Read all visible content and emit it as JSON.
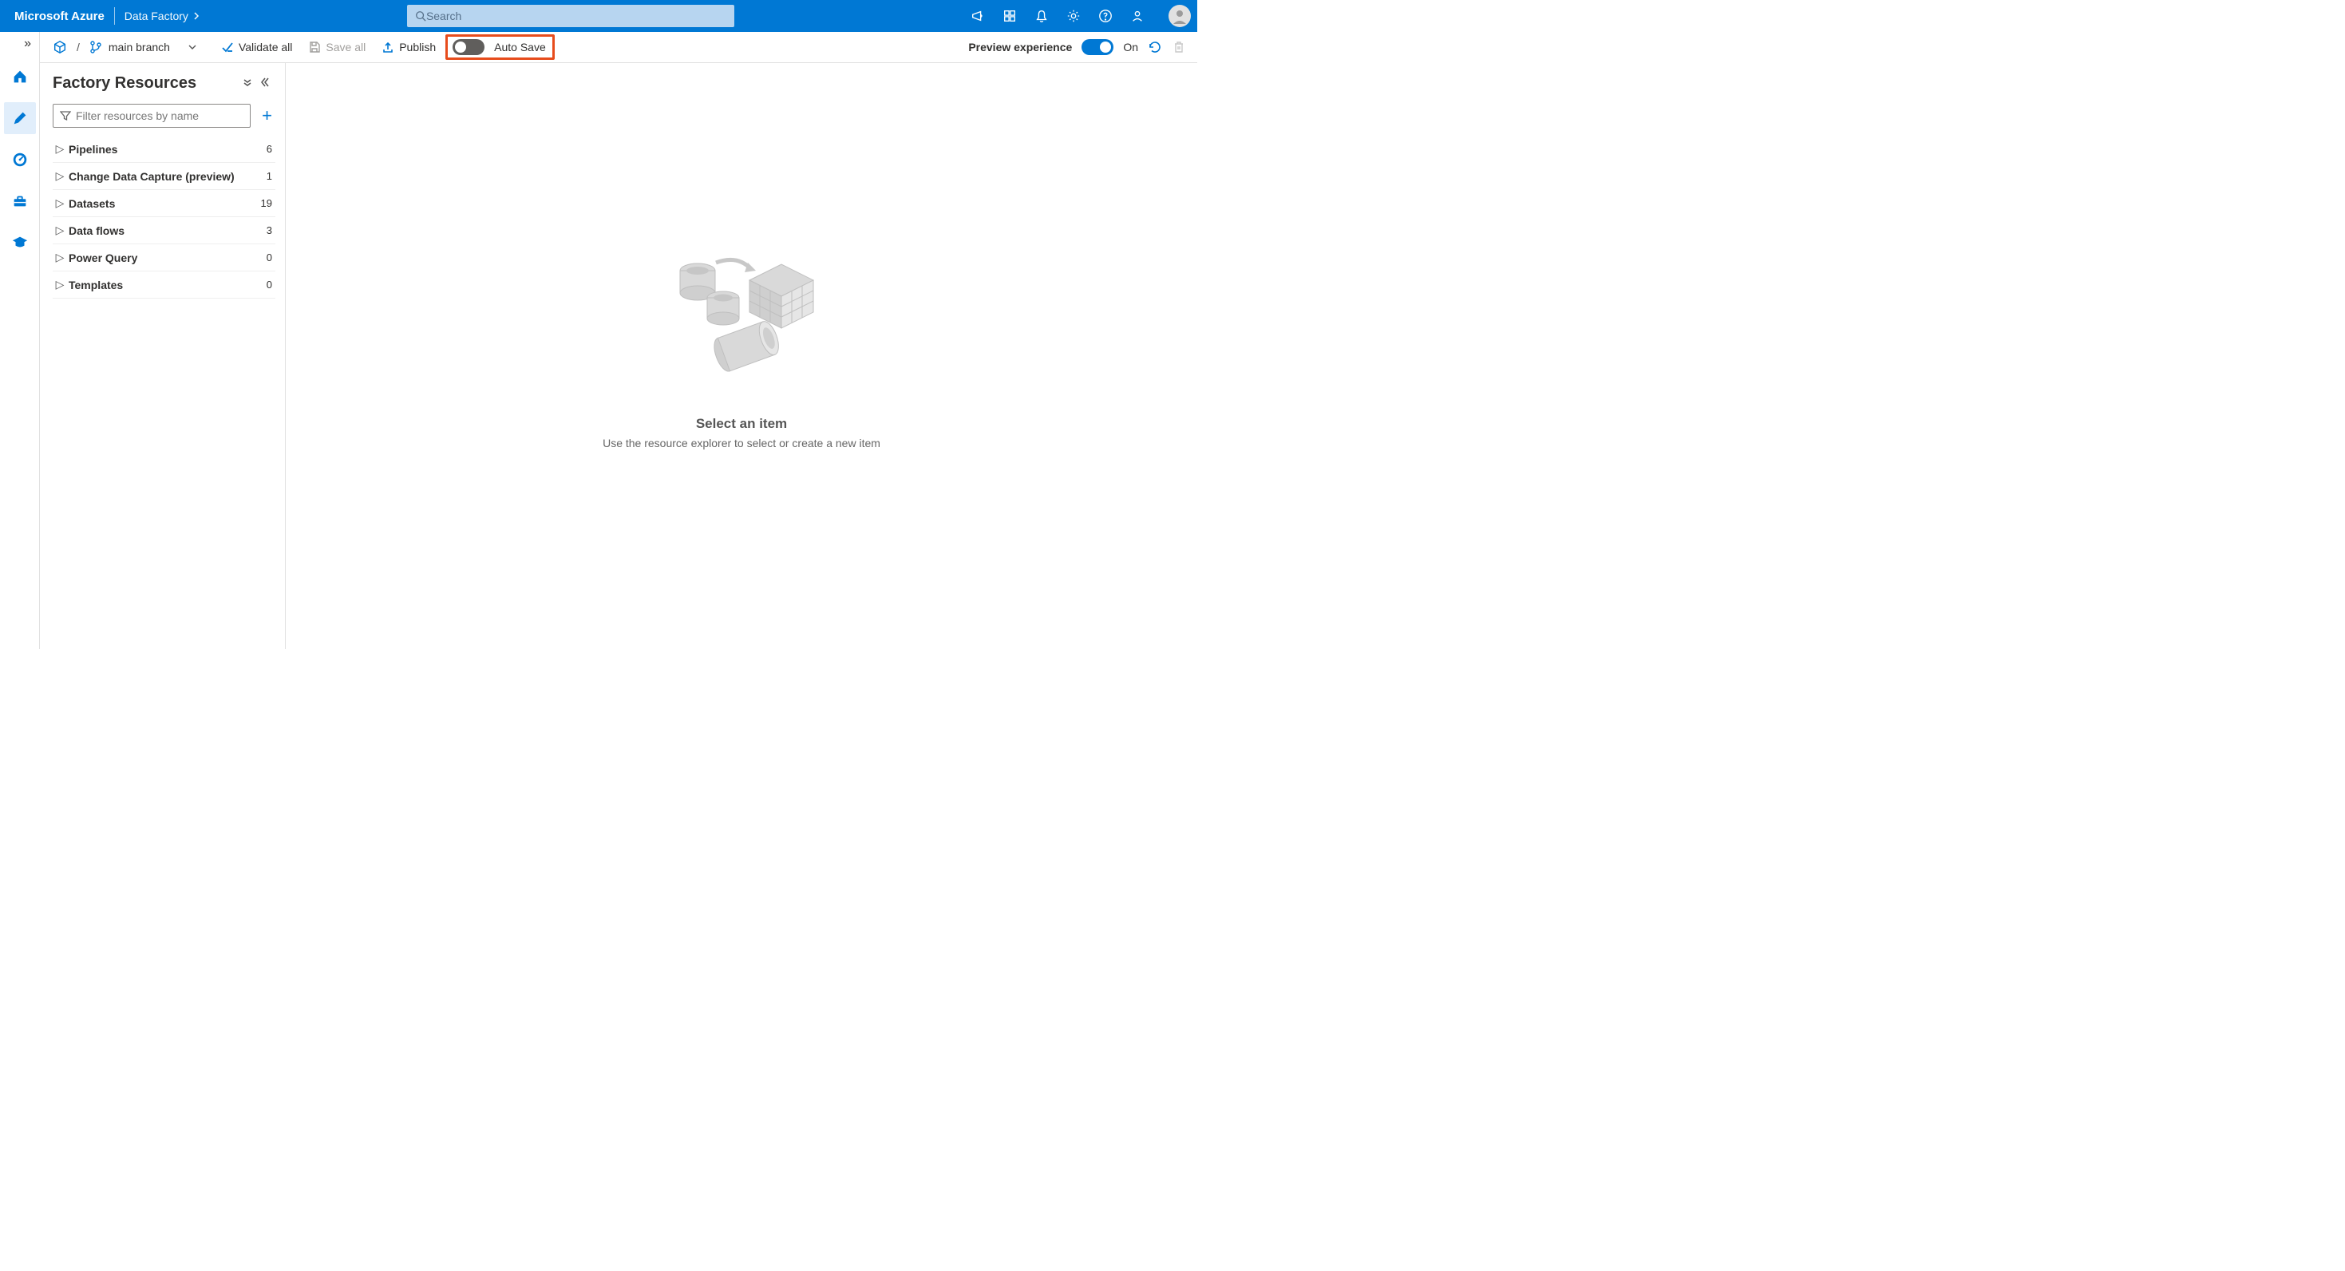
{
  "header": {
    "brand": "Microsoft Azure",
    "crumb": "Data Factory",
    "search_placeholder": "Search"
  },
  "toolbar": {
    "branch_label": "main branch",
    "validate_label": "Validate all",
    "save_all_label": "Save all",
    "publish_label": "Publish",
    "autosave_label": "Auto Save",
    "preview_label": "Preview experience",
    "preview_state": "On"
  },
  "panel": {
    "title": "Factory Resources",
    "filter_placeholder": "Filter resources by name",
    "items": [
      {
        "label": "Pipelines",
        "count": "6"
      },
      {
        "label": "Change Data Capture (preview)",
        "count": "1"
      },
      {
        "label": "Datasets",
        "count": "19"
      },
      {
        "label": "Data flows",
        "count": "3"
      },
      {
        "label": "Power Query",
        "count": "0"
      },
      {
        "label": "Templates",
        "count": "0"
      }
    ]
  },
  "empty": {
    "title": "Select an item",
    "subtitle": "Use the resource explorer to select or create a new item"
  }
}
